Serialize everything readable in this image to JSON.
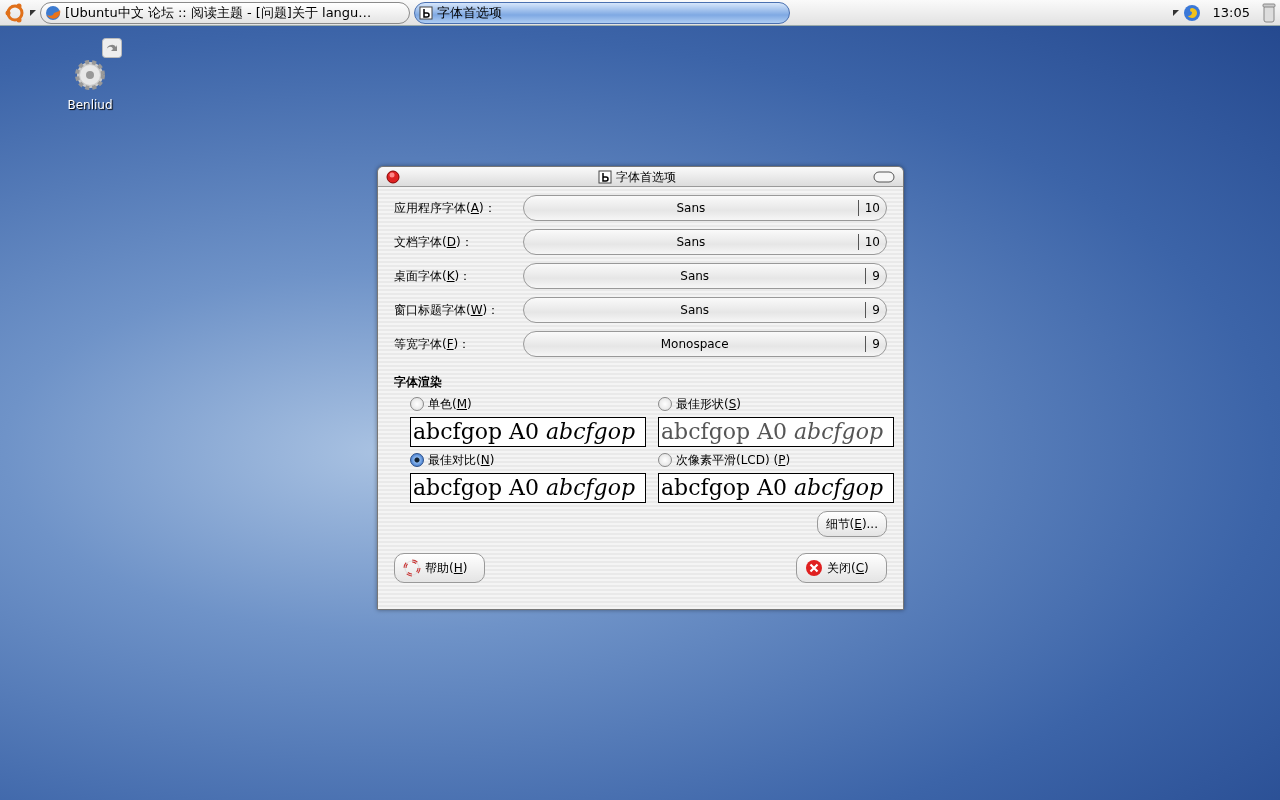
{
  "taskbar": {
    "tasks": [
      {
        "title": "[Ubuntu中文 论坛 :: 阅读主题 - [问题]关于 langu…",
        "kind": "browser",
        "selected": false
      },
      {
        "title": "字体首选项",
        "kind": "font",
        "selected": true
      }
    ],
    "clock": "13:05"
  },
  "desktop_icons": [
    {
      "label": "Benliud"
    }
  ],
  "window": {
    "title": "字体首选项",
    "font_rows": [
      {
        "label_before": "应用程序字体(",
        "key": "A",
        "label_after": ")：",
        "font": "Sans",
        "size": "10"
      },
      {
        "label_before": "文档字体(",
        "key": "D",
        "label_after": ")：",
        "font": "Sans",
        "size": "10"
      },
      {
        "label_before": "桌面字体(",
        "key": "K",
        "label_after": ")：",
        "font": "Sans",
        "size": "9"
      },
      {
        "label_before": "窗口标题字体(",
        "key": "W",
        "label_after": ")：",
        "font": "Sans",
        "size": "9"
      },
      {
        "label_before": "等宽字体(",
        "key": "F",
        "label_after": ")：",
        "font": "Monospace",
        "size": "9"
      }
    ],
    "rendering": {
      "heading": "字体渲染",
      "options": [
        {
          "label_before": "单色(",
          "key": "M",
          "label_after": ")",
          "selected": false,
          "preview": "abcfgop A0 *abcfgop*"
        },
        {
          "label_before": "最佳形状(",
          "key": "S",
          "label_after": ")",
          "selected": false,
          "preview": "abcfgop A0 *abcfgop*"
        },
        {
          "label_before": "最佳对比(",
          "key": "N",
          "label_after": ")",
          "selected": true,
          "preview": "abcfgop A0 *abcfgop*"
        },
        {
          "label_before": "次像素平滑(LCD) (",
          "key": "P",
          "label_after": ")",
          "selected": false,
          "preview": "abcfgop A0 *abcfgop*"
        }
      ]
    },
    "details_button": {
      "label_before": "细节(",
      "key": "E",
      "label_after": ")..."
    },
    "help_button": {
      "label_before": "帮助(",
      "key": "H",
      "label_after": ")"
    },
    "close_button": {
      "label_before": "关闭(",
      "key": "C",
      "label_after": ")"
    }
  }
}
